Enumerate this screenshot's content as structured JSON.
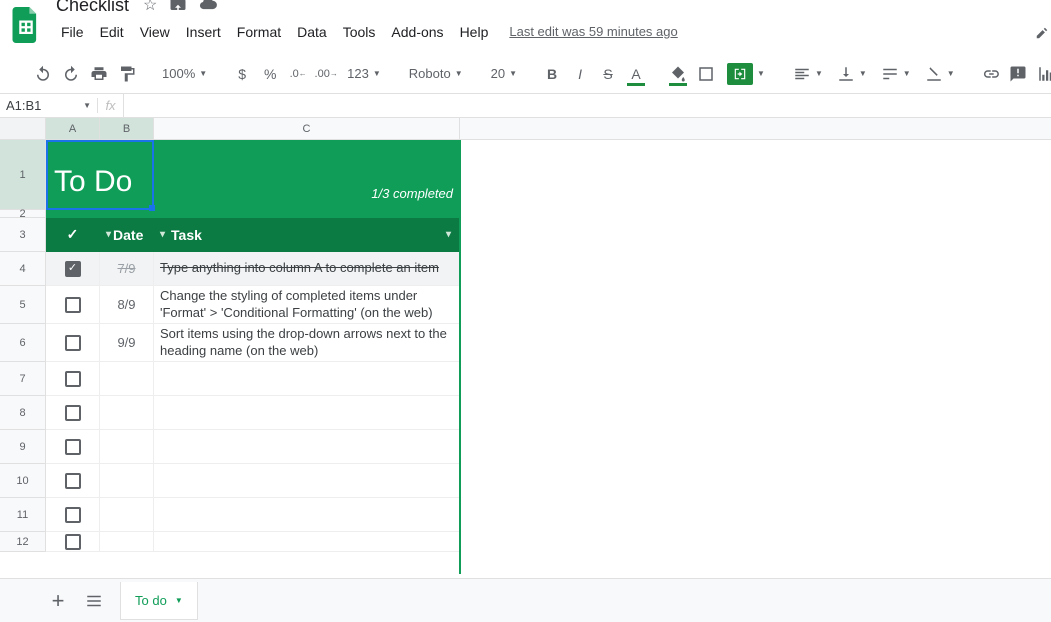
{
  "doc": {
    "title": "Checklist",
    "last_edit": "Last edit was 59 minutes ago"
  },
  "menus": {
    "file": "File",
    "edit": "Edit",
    "view": "View",
    "insert": "Insert",
    "format": "Format",
    "data": "Data",
    "tools": "Tools",
    "addons": "Add-ons",
    "help": "Help"
  },
  "toolbar": {
    "zoom": "100%",
    "currency": "$",
    "percent": "%",
    "decless": ".0",
    "decmore": ".00",
    "numfmt": "123",
    "font": "Roboto",
    "fontsize": "20"
  },
  "namebox": "A1:B1",
  "columns": {
    "A": "A",
    "B": "B",
    "C": "C"
  },
  "sheet": {
    "title": "To Do",
    "completed": "1/3 completed",
    "hdr_check": "✓",
    "hdr_date": "Date",
    "hdr_task": "Task",
    "rows": [
      {
        "num": "1"
      },
      {
        "num": "2"
      },
      {
        "num": "3"
      },
      {
        "num": "4",
        "checked": true,
        "date": "7/9",
        "task": "Type anything into column A to complete an item",
        "strike": true
      },
      {
        "num": "5",
        "checked": false,
        "date": "8/9",
        "task": "Change the styling of completed items under 'Format' > 'Conditional Formatting' (on the web)"
      },
      {
        "num": "6",
        "checked": false,
        "date": "9/9",
        "task": "Sort items using the drop-down arrows next to the heading name (on the web)"
      },
      {
        "num": "7",
        "checked": false,
        "date": "",
        "task": ""
      },
      {
        "num": "8",
        "checked": false,
        "date": "",
        "task": ""
      },
      {
        "num": "9",
        "checked": false,
        "date": "",
        "task": ""
      },
      {
        "num": "10",
        "checked": false,
        "date": "",
        "task": ""
      },
      {
        "num": "11",
        "checked": false,
        "date": "",
        "task": ""
      },
      {
        "num": "12",
        "checked": false,
        "date": "",
        "task": ""
      }
    ]
  },
  "tab": {
    "name": "To do"
  }
}
